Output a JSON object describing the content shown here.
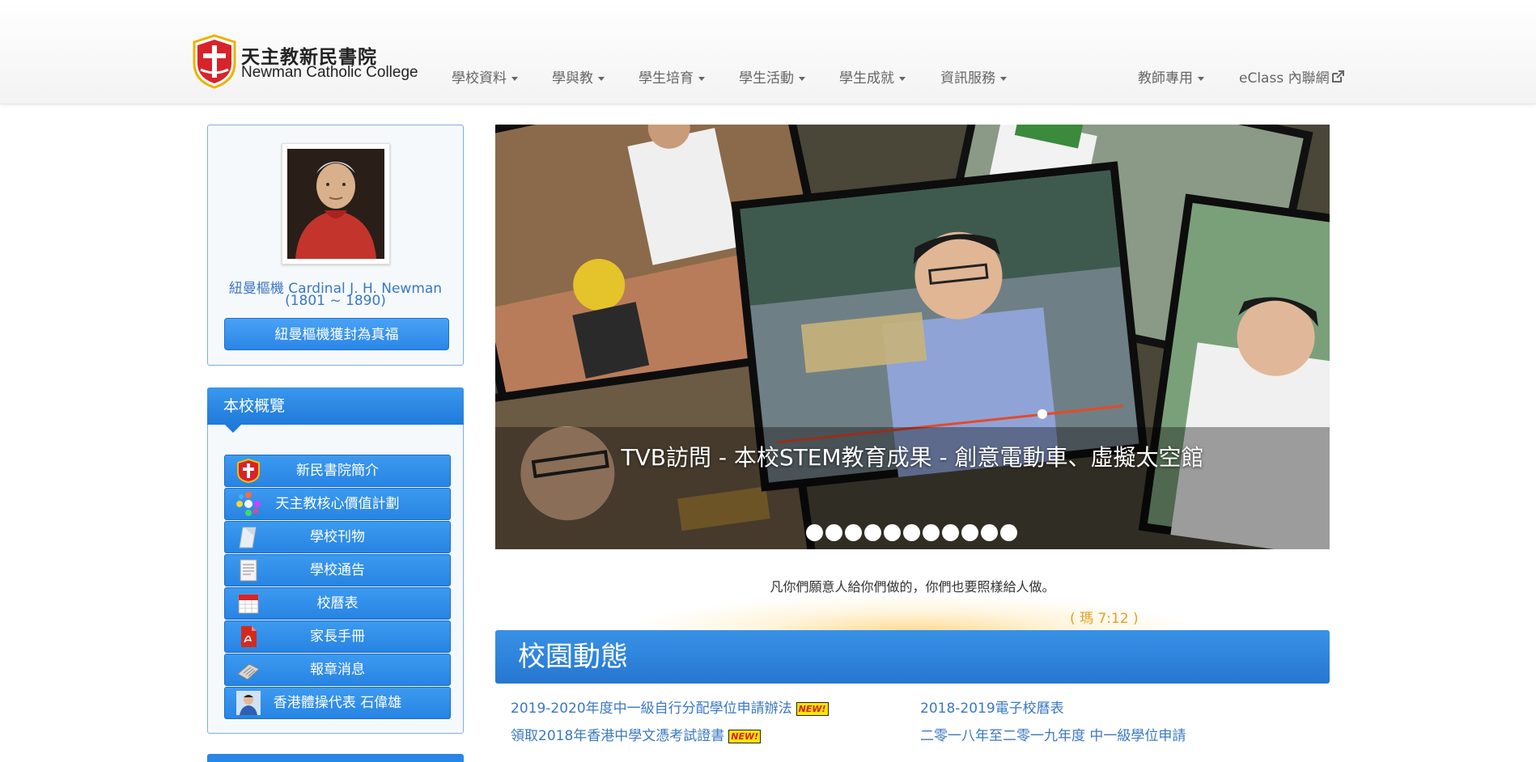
{
  "header": {
    "logo": {
      "name_zh": "天主教新民書院",
      "name_en": "Newman Catholic College"
    },
    "nav": [
      {
        "label": "學校資料"
      },
      {
        "label": "學與教"
      },
      {
        "label": "學生培育"
      },
      {
        "label": "學生活動"
      },
      {
        "label": "學生成就"
      },
      {
        "label": "資訊服務"
      }
    ],
    "nav_right": [
      {
        "label": "教師專用"
      },
      {
        "label": "eClass 內聯網"
      }
    ]
  },
  "sidebar": {
    "profile": {
      "caption_line1": "紐曼樞機 Cardinal J. H. Newman",
      "caption_line2": "(1801 ~ 1890)",
      "button": "紐曼樞機獲封為真福"
    },
    "overview": {
      "title": "本校概覽",
      "items": [
        {
          "label": "新民書院簡介",
          "icon": "school-crest-icon"
        },
        {
          "label": "天主教核心價值計劃",
          "icon": "core-values-icon"
        },
        {
          "label": "學校刊物",
          "icon": "publication-icon"
        },
        {
          "label": "學校通告",
          "icon": "notice-icon"
        },
        {
          "label": "校曆表",
          "icon": "calendar-icon"
        },
        {
          "label": "家長手冊",
          "icon": "pdf-icon"
        },
        {
          "label": "報章消息",
          "icon": "newspaper-icon"
        },
        {
          "label": "香港體操代表 石偉雄",
          "icon": "athlete-photo-icon"
        }
      ]
    }
  },
  "slideshow": {
    "caption": "TVB訪問 - 本校STEM教育成果 - 創意電動車、虛擬太空館",
    "slide_count": 11,
    "active_index": 0
  },
  "quote": {
    "text": "凡你們願意人給你們做的，你們也要照樣給人做。",
    "ref": "( 瑪 7:12 )"
  },
  "news": {
    "title": "校園動態",
    "left": [
      {
        "title": "2019-2020年度中一級自行分配學位申請辦法",
        "badge": "NEW!"
      },
      {
        "title": "領取2018年香港中學文憑考試證書",
        "badge": "NEW!"
      }
    ],
    "right": [
      {
        "title": "2018-2019電子校曆表"
      },
      {
        "title": "二零一八年至二零一九年度 中一級學位申請"
      }
    ]
  },
  "colors": {
    "accent_blue": "#2a86e6",
    "link_blue": "#3a78c4",
    "quote_ref_gold": "#e3a024",
    "badge_yellow": "#ffe600"
  }
}
